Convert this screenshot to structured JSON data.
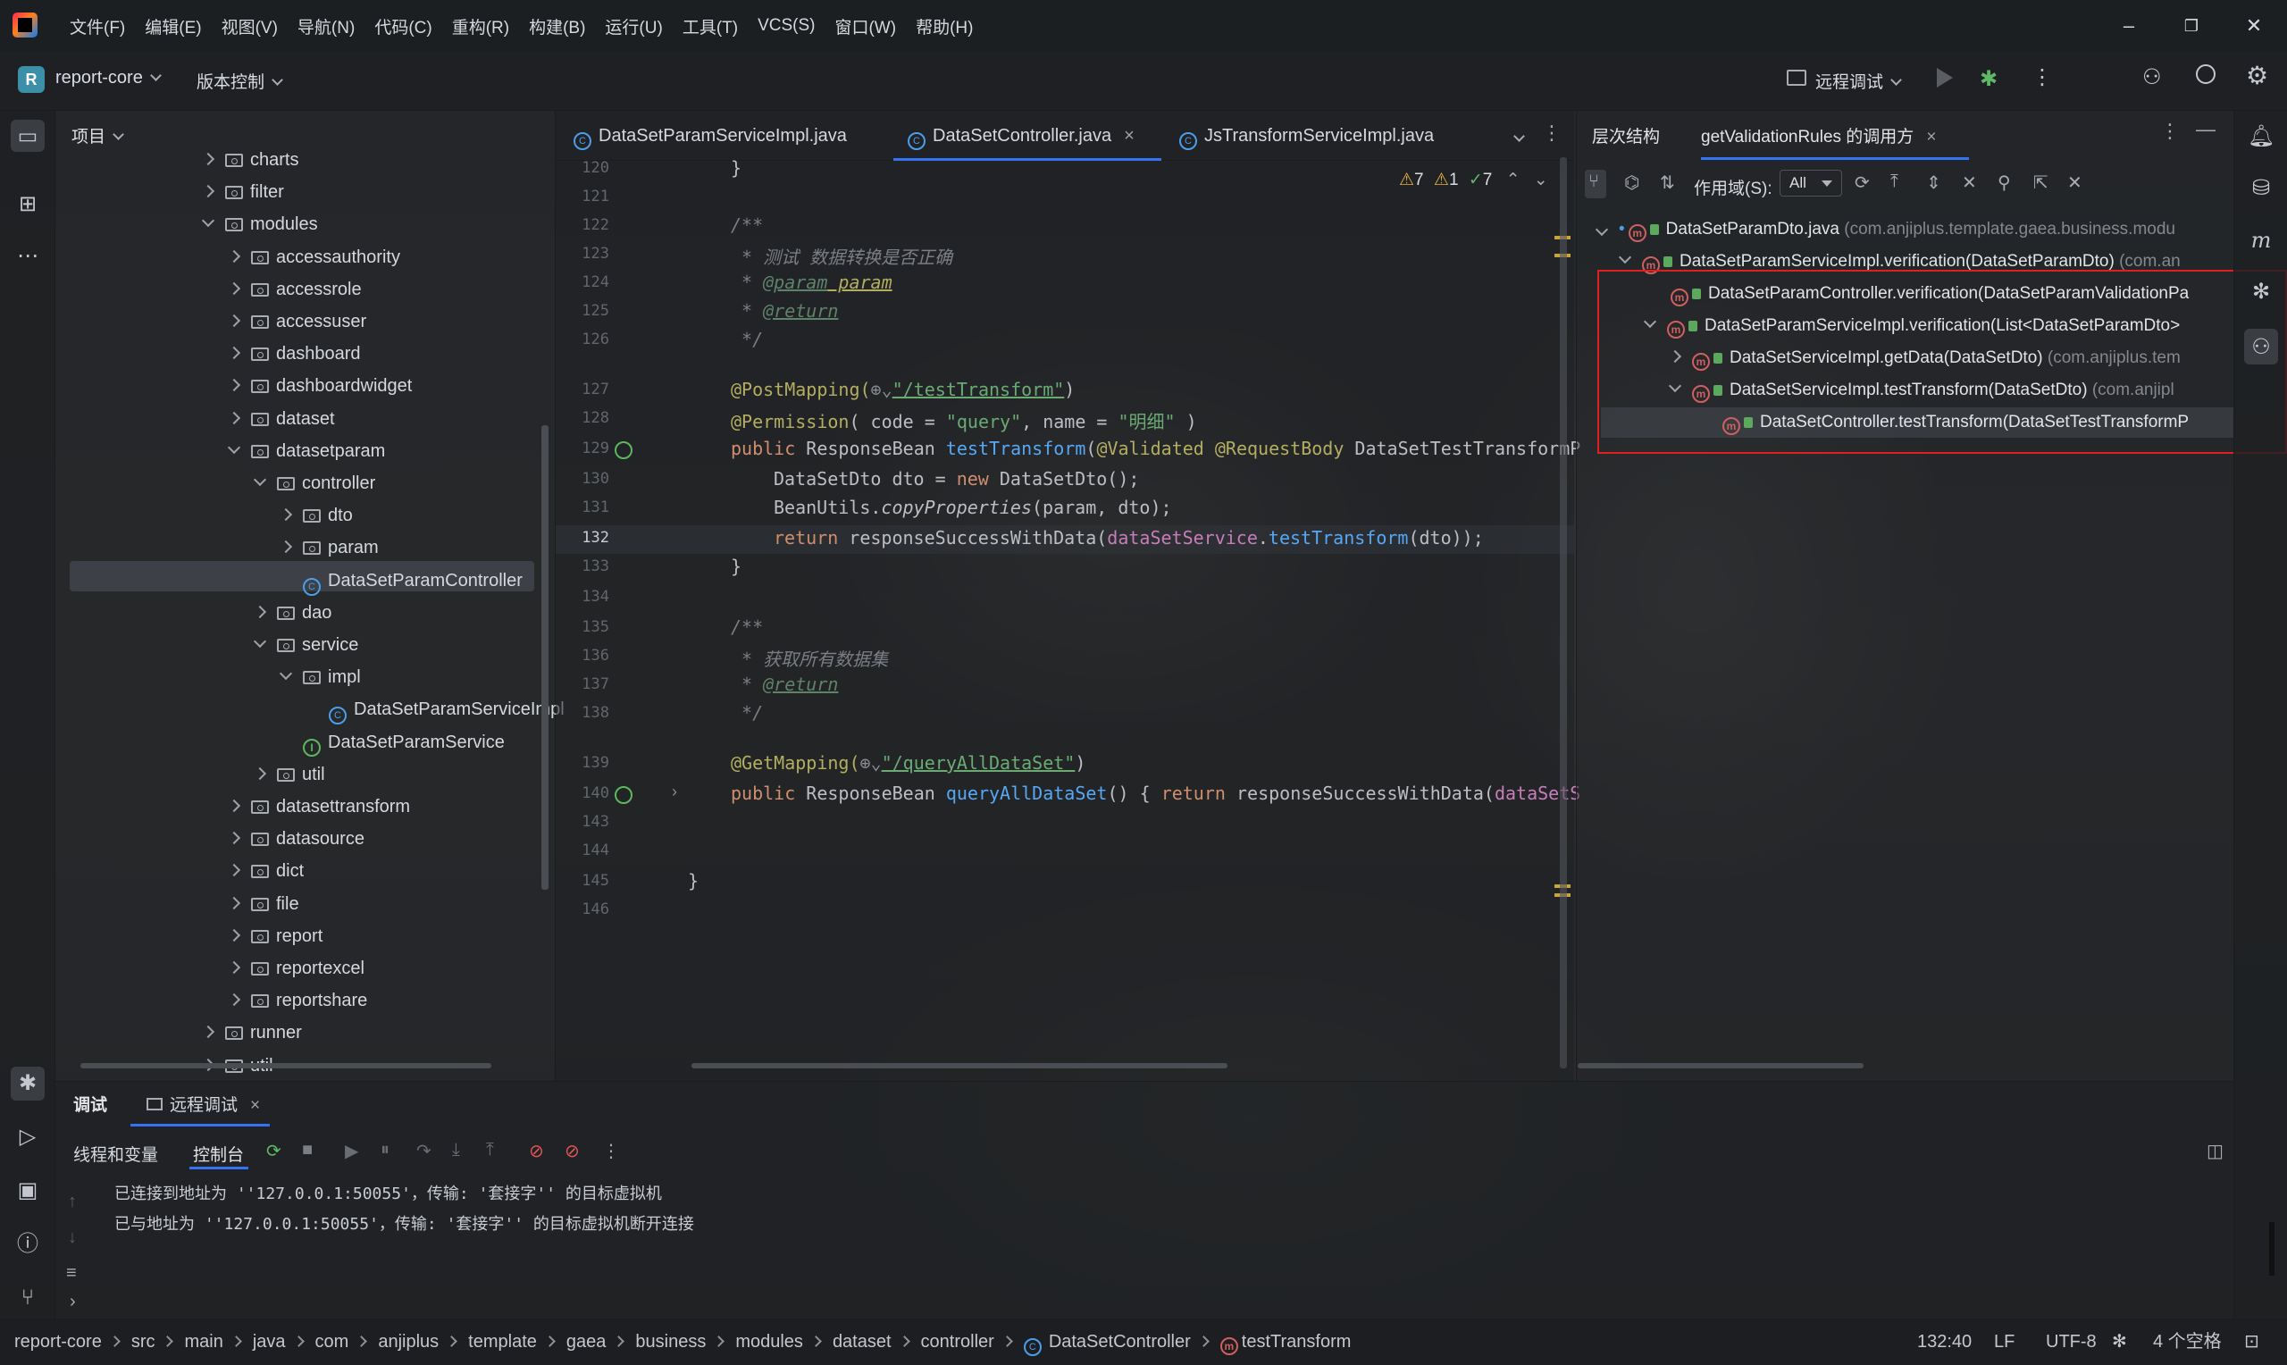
{
  "menu": [
    "文件(F)",
    "编辑(E)",
    "视图(V)",
    "导航(N)",
    "代码(C)",
    "重构(R)",
    "构建(B)",
    "运行(U)",
    "工具(T)",
    "VCS(S)",
    "窗口(W)",
    "帮助(H)"
  ],
  "toolbar": {
    "project_badge": "R",
    "project": "report-core",
    "vcs": "版本控制",
    "run_config": "远程调试"
  },
  "project_panel": {
    "title": "项目",
    "tree": [
      {
        "label": "charts",
        "depth": 1,
        "kind": "folder",
        "state": "collapsed"
      },
      {
        "label": "filter",
        "depth": 1,
        "kind": "folder",
        "state": "collapsed"
      },
      {
        "label": "modules",
        "depth": 1,
        "kind": "folder",
        "state": "expanded"
      },
      {
        "label": "accessauthority",
        "depth": 2,
        "kind": "folder",
        "state": "collapsed"
      },
      {
        "label": "accessrole",
        "depth": 2,
        "kind": "folder",
        "state": "collapsed"
      },
      {
        "label": "accessuser",
        "depth": 2,
        "kind": "folder",
        "state": "collapsed"
      },
      {
        "label": "dashboard",
        "depth": 2,
        "kind": "folder",
        "state": "collapsed"
      },
      {
        "label": "dashboardwidget",
        "depth": 2,
        "kind": "folder",
        "state": "collapsed"
      },
      {
        "label": "dataset",
        "depth": 2,
        "kind": "folder",
        "state": "collapsed"
      },
      {
        "label": "datasetparam",
        "depth": 2,
        "kind": "folder",
        "state": "expanded"
      },
      {
        "label": "controller",
        "depth": 3,
        "kind": "folder",
        "state": "expanded"
      },
      {
        "label": "dto",
        "depth": 4,
        "kind": "folder",
        "state": "collapsed"
      },
      {
        "label": "param",
        "depth": 4,
        "kind": "folder",
        "state": "collapsed"
      },
      {
        "label": "DataSetParamController",
        "depth": 4,
        "kind": "class",
        "state": "none"
      },
      {
        "label": "dao",
        "depth": 3,
        "kind": "folder",
        "state": "collapsed"
      },
      {
        "label": "service",
        "depth": 3,
        "kind": "folder",
        "state": "expanded"
      },
      {
        "label": "impl",
        "depth": 4,
        "kind": "folder",
        "state": "expanded"
      },
      {
        "label": "DataSetParamServiceImpl",
        "depth": 5,
        "kind": "class",
        "state": "none"
      },
      {
        "label": "DataSetParamService",
        "depth": 4,
        "kind": "interface",
        "state": "none"
      },
      {
        "label": "util",
        "depth": 3,
        "kind": "folder",
        "state": "collapsed"
      },
      {
        "label": "datasettransform",
        "depth": 2,
        "kind": "folder",
        "state": "collapsed"
      },
      {
        "label": "datasource",
        "depth": 2,
        "kind": "folder",
        "state": "collapsed"
      },
      {
        "label": "dict",
        "depth": 2,
        "kind": "folder",
        "state": "collapsed"
      },
      {
        "label": "file",
        "depth": 2,
        "kind": "folder",
        "state": "collapsed"
      },
      {
        "label": "report",
        "depth": 2,
        "kind": "folder",
        "state": "collapsed"
      },
      {
        "label": "reportexcel",
        "depth": 2,
        "kind": "folder",
        "state": "collapsed"
      },
      {
        "label": "reportshare",
        "depth": 2,
        "kind": "folder",
        "state": "collapsed"
      },
      {
        "label": "runner",
        "depth": 1,
        "kind": "folder",
        "state": "collapsed"
      },
      {
        "label": "util",
        "depth": 1,
        "kind": "folder",
        "state": "collapsed"
      }
    ]
  },
  "tabs": [
    {
      "label": "DataSetParamServiceImpl.java",
      "active": false
    },
    {
      "label": "DataSetController.java",
      "active": true
    },
    {
      "label": "JsTransformServiceImpl.java",
      "active": false
    }
  ],
  "inspections": {
    "warnings": "7",
    "weak": "1",
    "ok": "7"
  },
  "line_numbers": [
    "120",
    "121",
    "122",
    "123",
    "124",
    "125",
    "126",
    "127",
    "128",
    "129",
    "130",
    "131",
    "132",
    "133",
    "134",
    "135",
    "136",
    "137",
    "138",
    "139",
    "140",
    "143",
    "144",
    "145",
    "146"
  ],
  "code": {
    "l120": "}",
    "l122": "/**",
    "l123_a": " * ",
    "l123_b": "测试 数据转换是否正确",
    "l124_a": " * ",
    "l124_b": "@param",
    "l124_c": " param",
    "l125_a": " * ",
    "l125_b": "@return",
    "l126": " */",
    "l127_a": "@PostMapping(",
    "l127_b": "\"/testTransform\"",
    "l127_c": ")",
    "l128_a": "@Permission",
    "l128_b": "( code = ",
    "l128_c": "\"query\"",
    "l128_d": ", name = ",
    "l128_e": "\"明细\"",
    "l128_f": " )",
    "l129_a": "public ",
    "l129_b": "ResponseBean ",
    "l129_c": "testTransform",
    "l129_d": "(",
    "l129_e": "@Validated @RequestBody ",
    "l129_f": "DataSetTestTransformP",
    "l130_a": "DataSetDto dto = ",
    "l130_b": "new ",
    "l130_c": "DataSetDto();",
    "l131_a": "BeanUtils.",
    "l131_b": "copyProperties",
    "l131_c": "(param, dto);",
    "l132_a": "return ",
    "l132_b": "responseSuccessWithData(",
    "l132_c": "dataSetService",
    "l132_d": ".",
    "l132_e": "testTransform",
    "l132_f": "(dto));",
    "l133": "}",
    "l135": "/**",
    "l136_a": " * ",
    "l136_b": "获取所有数据集",
    "l137_a": " * ",
    "l137_b": "@return",
    "l138": " */",
    "l139_a": "@GetMapping(",
    "l139_b": "\"/queryAllDataSet\"",
    "l139_c": ")",
    "l140_a": "public ",
    "l140_b": "ResponseBean ",
    "l140_c": "queryAllDataSet",
    "l140_d": "() { ",
    "l140_e": "return ",
    "l140_f": "responseSuccessWithData(",
    "l140_g": "dataSetS",
    "l145": "}"
  },
  "hierarchy": {
    "tab1": "层次结构",
    "tab2": "getValidationRules 的调用方",
    "scope_label": "作用域(S):",
    "scope_value": "All",
    "rows": [
      {
        "name": "DataSetParamDto.java",
        "pkg": "(com.anjiplus.template.gaea.business.modu"
      },
      {
        "name": "DataSetParamServiceImpl.verification(DataSetParamDto)",
        "pkg": "(com.an"
      },
      {
        "name": "DataSetParamController.verification(DataSetParamValidationPa",
        "pkg": ""
      },
      {
        "name": "DataSetParamServiceImpl.verification(List<DataSetParamDto>",
        "pkg": ""
      },
      {
        "name": "DataSetServiceImpl.getData(DataSetDto)",
        "pkg": "(com.anjiplus.tem"
      },
      {
        "name": "DataSetServiceImpl.testTransform(DataSetDto)",
        "pkg": "(com.anjipl"
      },
      {
        "name": "DataSetController.testTransform(DataSetTestTransformP",
        "pkg": ""
      }
    ]
  },
  "bottom": {
    "tab_debug": "调试",
    "tab_remote": "远程调试",
    "sub_threads": "线程和变量",
    "sub_console": "控制台",
    "console": [
      "已连接到地址为 ''127.0.0.1:50055'，传输: '套接字'' 的目标虚拟机",
      "已与地址为 ''127.0.0.1:50055'，传输: '套接字'' 的目标虚拟机断开连接"
    ]
  },
  "status": {
    "breadcrumb": [
      "report-core",
      "src",
      "main",
      "java",
      "com",
      "anjiplus",
      "template",
      "gaea",
      "business",
      "modules",
      "dataset",
      "controller",
      "DataSetController",
      "testTransform"
    ],
    "position": "132:40",
    "line_sep": "LF",
    "encoding": "UTF-8",
    "indent": "4 个空格"
  }
}
